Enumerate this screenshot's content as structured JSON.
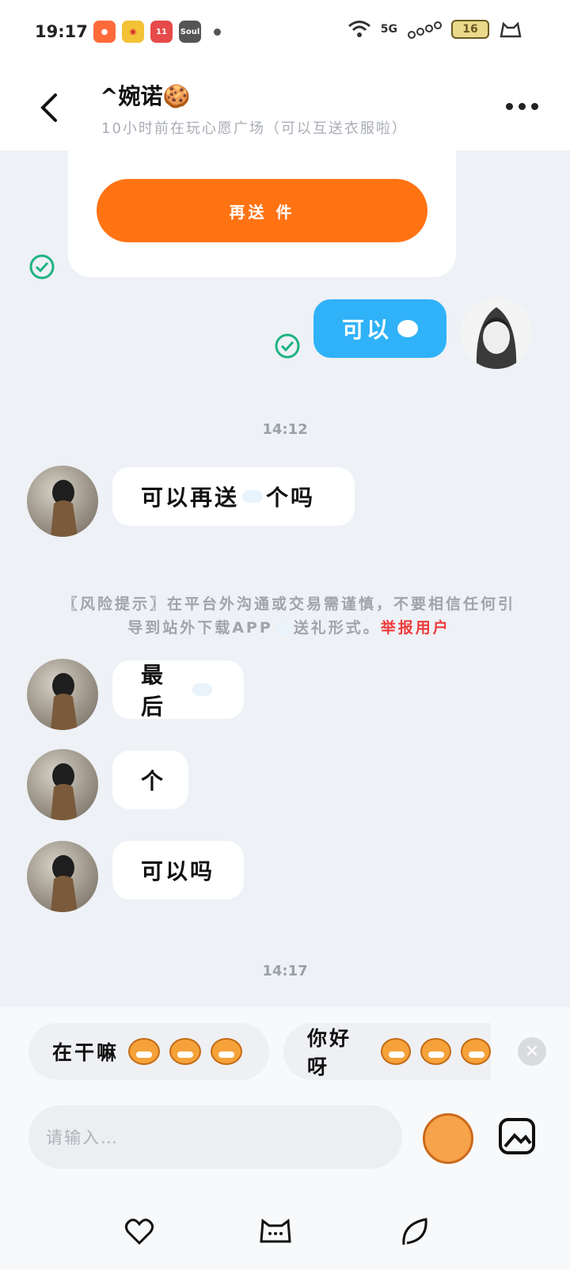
{
  "status": {
    "time": "19:17",
    "app_icons": [
      "app-icon-orange",
      "weibo-icon",
      "app-icon-1111",
      "soul-icon"
    ],
    "soul_label": "Soul",
    "network": "5G",
    "battery": "16"
  },
  "header": {
    "title": "^婉诺🍪",
    "subtitle": "10小时前在玩心愿广场（可以互送衣服啦）"
  },
  "messages": {
    "gift_button": "再送 件",
    "me_reply": "可以",
    "ts1": "14:12",
    "m1_a": "可以再送",
    "m1_b": "个吗",
    "risk_a": "〖风险提示〗在平台外沟通或交易需谨慎，不要相信任何引导到站外下载APP",
    "risk_b": "送礼形式。",
    "risk_report": "举报用户",
    "m2": "最后",
    "m3": "个",
    "m4": "可以吗",
    "ts2": "14:17"
  },
  "quick_replies": [
    "在干嘛",
    "你好呀"
  ],
  "input": {
    "placeholder": "请输入…"
  },
  "colors": {
    "accent": "#30b2f8",
    "gift": "#ff7313",
    "report": "#ef3a3a"
  }
}
